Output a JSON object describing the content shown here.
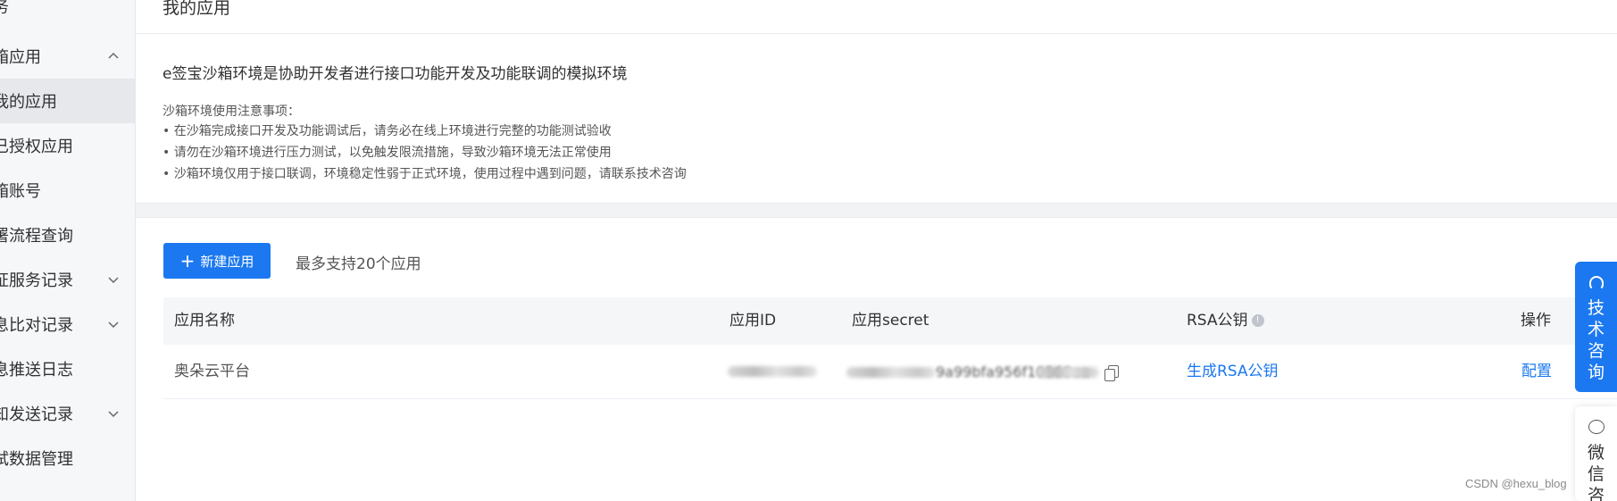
{
  "sidebar": {
    "items": [
      {
        "label": "务"
      },
      {
        "label": "箱应用"
      },
      {
        "label": "我的应用"
      },
      {
        "label": "已授权应用"
      },
      {
        "label": "箱账号"
      },
      {
        "label": "署流程查询"
      },
      {
        "label": "证服务记录"
      },
      {
        "label": "息比对记录"
      },
      {
        "label": "息推送日志"
      },
      {
        "label": "知发送记录"
      },
      {
        "label": "试数据管理"
      }
    ]
  },
  "header": {
    "title": "我的应用"
  },
  "notice": {
    "headline": "e签宝沙箱环境是协助开发者进行接口功能开发及功能联调的模拟环境",
    "sub_title": "沙箱环境使用注意事项：",
    "bullets": [
      "• 在沙箱完成接口开发及功能调试后，请务必在线上环境进行完整的功能测试验收",
      "• 请勿在沙箱环境进行压力测试，以免触发限流措施，导致沙箱环境无法正常使用",
      "• 沙箱环境仅用于接口联调，环境稳定性弱于正式环境，使用过程中遇到问题，请联系技术咨询"
    ]
  },
  "toolbar": {
    "new_app_label": "新建应用",
    "limit_text": "最多支持20个应用"
  },
  "table": {
    "headers": {
      "name": "应用名称",
      "app_id": "应用ID",
      "secret": "应用secret",
      "rsa": "RSA公钥",
      "action": "操作"
    },
    "rows": [
      {
        "name": "奥朵云平台",
        "secret_visible_tail": "9a99bfa956f10569ea",
        "rsa_link": "生成RSA公钥",
        "action_link": "配置"
      }
    ]
  },
  "float": {
    "consult_chars": [
      "技",
      "术",
      "咨",
      "询"
    ],
    "wechat_chars": [
      "微",
      "信",
      "咨"
    ]
  },
  "watermark": "CSDN @hexu_blog",
  "colors": {
    "primary": "#1b78f0",
    "sidebar_bg": "#f6f7f9",
    "active_bg": "#e6e8ec"
  }
}
